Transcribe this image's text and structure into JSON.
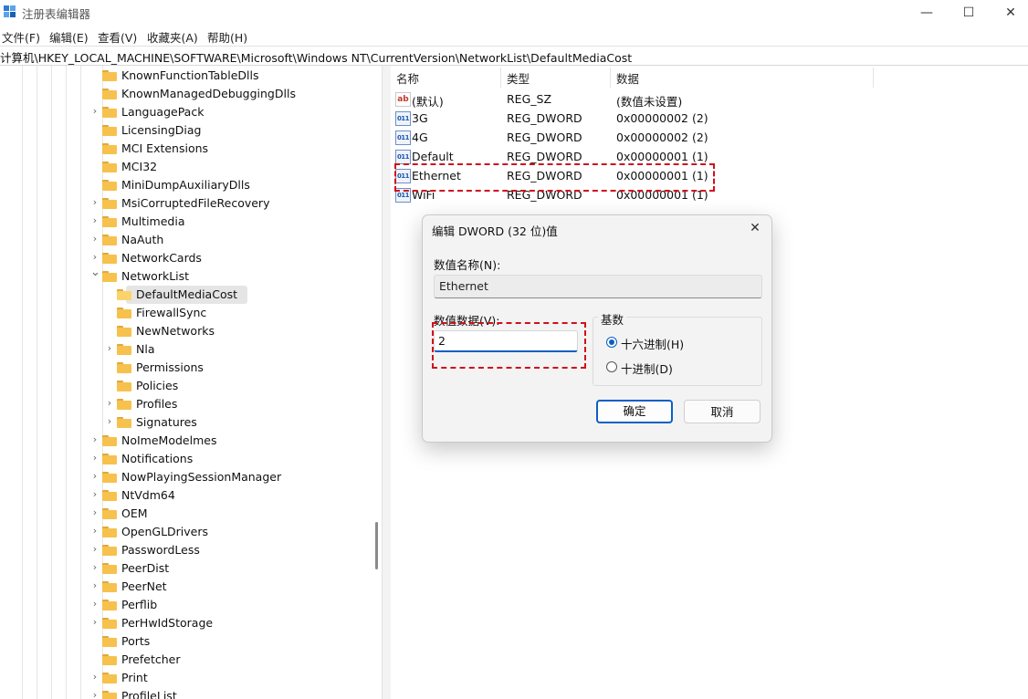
{
  "window": {
    "title": "注册表编辑器",
    "minimize": "—",
    "maximize": "☐",
    "close": "✕"
  },
  "menu": [
    "文件(F)",
    "编辑(E)",
    "查看(V)",
    "收藏夹(A)",
    "帮助(H)"
  ],
  "address": "计算机\\HKEY_LOCAL_MACHINE\\SOFTWARE\\Microsoft\\Windows NT\\CurrentVersion\\NetworkList\\DefaultMediaCost",
  "tree": [
    {
      "label": "KnownFunctionTableDlls",
      "level": 0,
      "expander": "none"
    },
    {
      "label": "KnownManagedDebuggingDlls",
      "level": 0,
      "expander": "none"
    },
    {
      "label": "LanguagePack",
      "level": 0,
      "expander": "collapsed"
    },
    {
      "label": "LicensingDiag",
      "level": 0,
      "expander": "none"
    },
    {
      "label": "MCI Extensions",
      "level": 0,
      "expander": "none"
    },
    {
      "label": "MCI32",
      "level": 0,
      "expander": "none"
    },
    {
      "label": "MiniDumpAuxiliaryDlls",
      "level": 0,
      "expander": "none"
    },
    {
      "label": "MsiCorruptedFileRecovery",
      "level": 0,
      "expander": "collapsed"
    },
    {
      "label": "Multimedia",
      "level": 0,
      "expander": "collapsed"
    },
    {
      "label": "NaAuth",
      "level": 0,
      "expander": "collapsed"
    },
    {
      "label": "NetworkCards",
      "level": 0,
      "expander": "collapsed"
    },
    {
      "label": "NetworkList",
      "level": 0,
      "expander": "expanded"
    },
    {
      "label": "DefaultMediaCost",
      "level": 1,
      "expander": "none",
      "selected": true
    },
    {
      "label": "FirewallSync",
      "level": 1,
      "expander": "none"
    },
    {
      "label": "NewNetworks",
      "level": 1,
      "expander": "none"
    },
    {
      "label": "Nla",
      "level": 1,
      "expander": "collapsed"
    },
    {
      "label": "Permissions",
      "level": 1,
      "expander": "none"
    },
    {
      "label": "Policies",
      "level": 1,
      "expander": "none"
    },
    {
      "label": "Profiles",
      "level": 1,
      "expander": "collapsed"
    },
    {
      "label": "Signatures",
      "level": 1,
      "expander": "collapsed"
    },
    {
      "label": "NoImeModelmes",
      "level": 0,
      "expander": "collapsed"
    },
    {
      "label": "Notifications",
      "level": 0,
      "expander": "collapsed"
    },
    {
      "label": "NowPlayingSessionManager",
      "level": 0,
      "expander": "collapsed"
    },
    {
      "label": "NtVdm64",
      "level": 0,
      "expander": "collapsed"
    },
    {
      "label": "OEM",
      "level": 0,
      "expander": "collapsed"
    },
    {
      "label": "OpenGLDrivers",
      "level": 0,
      "expander": "collapsed"
    },
    {
      "label": "PasswordLess",
      "level": 0,
      "expander": "collapsed"
    },
    {
      "label": "PeerDist",
      "level": 0,
      "expander": "collapsed"
    },
    {
      "label": "PeerNet",
      "level": 0,
      "expander": "collapsed"
    },
    {
      "label": "Perflib",
      "level": 0,
      "expander": "collapsed"
    },
    {
      "label": "PerHwIdStorage",
      "level": 0,
      "expander": "collapsed"
    },
    {
      "label": "Ports",
      "level": 0,
      "expander": "none"
    },
    {
      "label": "Prefetcher",
      "level": 0,
      "expander": "none"
    },
    {
      "label": "Print",
      "level": 0,
      "expander": "collapsed"
    },
    {
      "label": "ProfileList",
      "level": 0,
      "expander": "collapsed"
    }
  ],
  "values_headers": {
    "name": "名称",
    "type": "类型",
    "data": "数据"
  },
  "values": [
    {
      "icon": "string-value-icon",
      "glyph": "ab",
      "name": "(默认)",
      "type": "REG_SZ",
      "data": "(数值未设置)"
    },
    {
      "icon": "dword-value-icon",
      "glyph": "011",
      "name": "3G",
      "type": "REG_DWORD",
      "data": "0x00000002 (2)"
    },
    {
      "icon": "dword-value-icon",
      "glyph": "011",
      "name": "4G",
      "type": "REG_DWORD",
      "data": "0x00000002 (2)"
    },
    {
      "icon": "dword-value-icon",
      "glyph": "011",
      "name": "Default",
      "type": "REG_DWORD",
      "data": "0x00000001 (1)"
    },
    {
      "icon": "dword-value-icon",
      "glyph": "011",
      "name": "Ethernet",
      "type": "REG_DWORD",
      "data": "0x00000001 (1)"
    },
    {
      "icon": "dword-value-icon",
      "glyph": "011",
      "name": "WiFi",
      "type": "REG_DWORD",
      "data": "0x00000001 (1)"
    }
  ],
  "dialog": {
    "title": "编辑 DWORD (32 位)值",
    "close": "✕",
    "name_label": "数值名称(N):",
    "name_value": "Ethernet",
    "data_label": "数值数据(V):",
    "data_value": "2",
    "base_label": "基数",
    "radio_hex": "十六进制(H)",
    "radio_dec": "十进制(D)",
    "radio_selected": "hex",
    "ok": "确定",
    "cancel": "取消"
  },
  "colors": {
    "accent": "#0b5fc4",
    "highlight_box": "#d0101b",
    "folder": "#f7c14d"
  }
}
